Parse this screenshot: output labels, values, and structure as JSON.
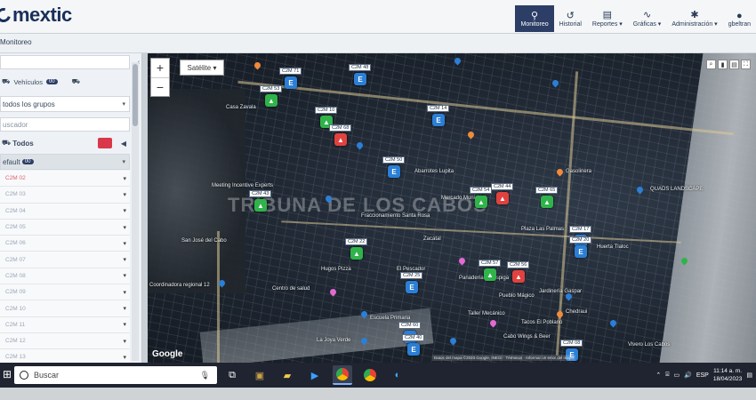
{
  "app": {
    "logo": "mextic"
  },
  "nav": [
    {
      "label": "Monitoreo",
      "icon": "map-pin-icon",
      "glyph": "⚲",
      "active": true
    },
    {
      "label": "Historial",
      "icon": "history-icon",
      "glyph": "↺",
      "active": false
    },
    {
      "label": "Reportes ▾",
      "icon": "report-icon",
      "glyph": "▤",
      "active": false
    },
    {
      "label": "Gráficas ▾",
      "icon": "chart-icon",
      "glyph": "∿",
      "active": false
    },
    {
      "label": "Administración ▾",
      "icon": "gear-icon",
      "glyph": "✱",
      "active": false
    },
    {
      "label": "gbeltran",
      "icon": "user-icon",
      "glyph": "●",
      "active": false
    }
  ],
  "page_title": "Monitoreo",
  "sidebar": {
    "tab_vehicles": "Vehículos",
    "tab_vehicles_count": "00",
    "groups_select": "todos los grupos",
    "search_placeholder": "uscador",
    "todos_label": "Todos",
    "group_label": "efault",
    "group_count": "00",
    "vehicles": [
      "C2M 02",
      "C2M 03",
      "C2M 04",
      "C2M 05",
      "C2M 06",
      "C2M 07",
      "C2M 08",
      "C2M 09",
      "C2M 10",
      "C2M 11",
      "C2M 12",
      "C2M 13"
    ]
  },
  "map": {
    "type_button": "Satélite",
    "zoom_in": "+",
    "zoom_out": "−",
    "google": "Google",
    "attribution": "Datos del mapa ©2023 Google, INEGI · Términos · Informar un error del mapa",
    "watermark": "TRIBUNA DE LOS CABOS",
    "places": [
      "Casa Zavala",
      "Meeting Incentive Experts",
      "San José del Cabo",
      "Coordinadora regional 12",
      "Centro de salud",
      "Hugos Pizza",
      "La Joya Verde",
      "Vivero Los Cabos",
      "QUADS LANDSCAPE",
      "Zacatal",
      "Huerta Tlaloc",
      "Chedraui",
      "Cabo Wings & Beer",
      "Pueblo Mágico",
      "Tacos El Poblano",
      "Jardinería Gaspar",
      "Fraccionamiento Santa Rosa",
      "El Pescador",
      "Panadería La Espiga",
      "Gasolinera",
      "Abarrotes Lupita",
      "Mercado Municipal",
      "Plaza Las Palmas",
      "Escuela Primaria",
      "Taller Mecánico"
    ],
    "vehicles": [
      {
        "label": "C2M 71",
        "mark": "E"
      },
      {
        "label": "C2M 53",
        "mark": "G"
      },
      {
        "label": "C2M 48",
        "mark": "E"
      },
      {
        "label": "C2M 10",
        "mark": "G"
      },
      {
        "label": "C2M 68",
        "mark": "R"
      },
      {
        "label": "C2M 14",
        "mark": "E"
      },
      {
        "label": "C2M 50",
        "mark": "E"
      },
      {
        "label": "C2M 43",
        "mark": "G"
      },
      {
        "label": "C2M 54",
        "mark": "G"
      },
      {
        "label": "C2M 44",
        "mark": "R"
      },
      {
        "label": "C2M 65",
        "mark": "G"
      },
      {
        "label": "C2M 17",
        "mark": "E"
      },
      {
        "label": "C2M 20",
        "mark": "E"
      },
      {
        "label": "C2M 22",
        "mark": "G"
      },
      {
        "label": "C2M 57",
        "mark": "G"
      },
      {
        "label": "C2M 56",
        "mark": "R"
      },
      {
        "label": "C2M 25",
        "mark": "E"
      },
      {
        "label": "C2M 60",
        "mark": "E"
      },
      {
        "label": "C2M 40",
        "mark": "E"
      },
      {
        "label": "C2M 08",
        "mark": "E"
      }
    ]
  },
  "taskbar": {
    "search": "Buscar",
    "time": "11:14 a. m.",
    "date": "18/04/2023",
    "lang": "ESP"
  }
}
